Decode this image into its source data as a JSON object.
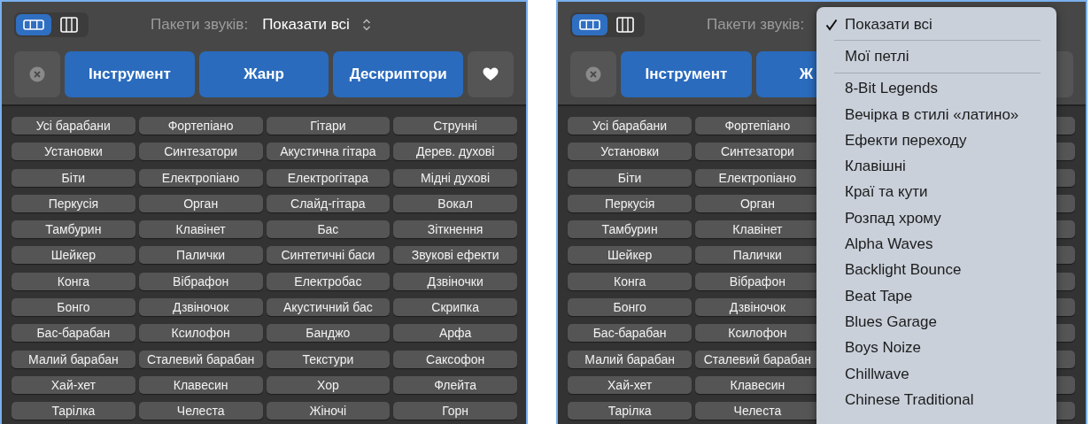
{
  "panels": [
    {
      "view_toggle": [
        {
          "selected": true
        },
        {
          "selected": false
        }
      ],
      "sound_packs": {
        "label": "Пакети звуків:",
        "value": "Показати всі"
      },
      "filter_buttons": [
        {
          "label": "Інструмент"
        },
        {
          "label": "Жанр"
        },
        {
          "label": "Дескриптори"
        }
      ],
      "tags": [
        [
          "Усі барабани",
          "Фортепіано",
          "Гітари",
          "Струнні"
        ],
        [
          "Установки",
          "Синтезатори",
          "Акустична гітара",
          "Дерев. духові"
        ],
        [
          "Біти",
          "Електропіано",
          "Електрогітара",
          "Мідні духові"
        ],
        [
          "Перкусія",
          "Орган",
          "Слайд-гітара",
          "Вокал"
        ],
        [
          "Тамбурин",
          "Клавінет",
          "Бас",
          "Зіткнення"
        ],
        [
          "Шейкер",
          "Палички",
          "Синтетичні баси",
          "Звукові ефекти"
        ],
        [
          "Конга",
          "Вібрафон",
          "Електробас",
          "Дзвіночки"
        ],
        [
          "Бонго",
          "Дзвіночок",
          "Акустичний бас",
          "Скрипка"
        ],
        [
          "Бас-барабан",
          "Ксилофон",
          "Банджо",
          "Арфа"
        ],
        [
          "Малий барабан",
          "Сталевий барабан",
          "Текстури",
          "Саксофон"
        ],
        [
          "Хай-хет",
          "Клавесин",
          "Хор",
          "Флейта"
        ],
        [
          "Тарілка",
          "Челеста",
          "Жіночі",
          "Горн"
        ]
      ]
    },
    {
      "view_toggle": [
        {
          "selected": true
        },
        {
          "selected": false
        }
      ],
      "sound_packs": {
        "label": "Пакети звуків:"
      },
      "filter_buttons": [
        {
          "label": "Інструмент"
        },
        {
          "label": "Ж"
        }
      ],
      "tags": [
        [
          "Усі барабани",
          "Фортепіано"
        ],
        [
          "Установки",
          "Синтезатори"
        ],
        [
          "Біти",
          "Електропіано"
        ],
        [
          "Перкусія",
          "Орган"
        ],
        [
          "Тамбурин",
          "Клавінет"
        ],
        [
          "Шейкер",
          "Палички"
        ],
        [
          "Конга",
          "Вібрафон"
        ],
        [
          "Бонго",
          "Дзвіночок"
        ],
        [
          "Бас-барабан",
          "Ксилофон"
        ],
        [
          "Малий барабан",
          "Сталевий барабан"
        ],
        [
          "Хай-хет",
          "Клавесин"
        ],
        [
          "Тарілка",
          "Челеста"
        ]
      ],
      "menu": {
        "items": [
          {
            "kind": "item",
            "label": "Показати всі",
            "selected": true
          },
          {
            "kind": "separator"
          },
          {
            "kind": "item",
            "label": "Мої петлі",
            "selected": false
          },
          {
            "kind": "separator"
          },
          {
            "kind": "item",
            "label": "8-Bit Legends",
            "selected": false
          },
          {
            "kind": "item",
            "label": "Вечірка в стилі «латино»",
            "selected": false
          },
          {
            "kind": "item",
            "label": "Ефекти переходу",
            "selected": false
          },
          {
            "kind": "item",
            "label": "Клавішні",
            "selected": false
          },
          {
            "kind": "item",
            "label": "Краї та кути",
            "selected": false
          },
          {
            "kind": "item",
            "label": "Розпад хрому",
            "selected": false
          },
          {
            "kind": "item",
            "label": "Alpha Waves",
            "selected": false
          },
          {
            "kind": "item",
            "label": "Backlight Bounce",
            "selected": false
          },
          {
            "kind": "item",
            "label": "Beat Tape",
            "selected": false
          },
          {
            "kind": "item",
            "label": "Blues Garage",
            "selected": false
          },
          {
            "kind": "item",
            "label": "Boys Noize",
            "selected": false
          },
          {
            "kind": "item",
            "label": "Chillwave",
            "selected": false
          },
          {
            "kind": "item",
            "label": "Chinese Traditional",
            "selected": false
          }
        ]
      }
    }
  ]
}
